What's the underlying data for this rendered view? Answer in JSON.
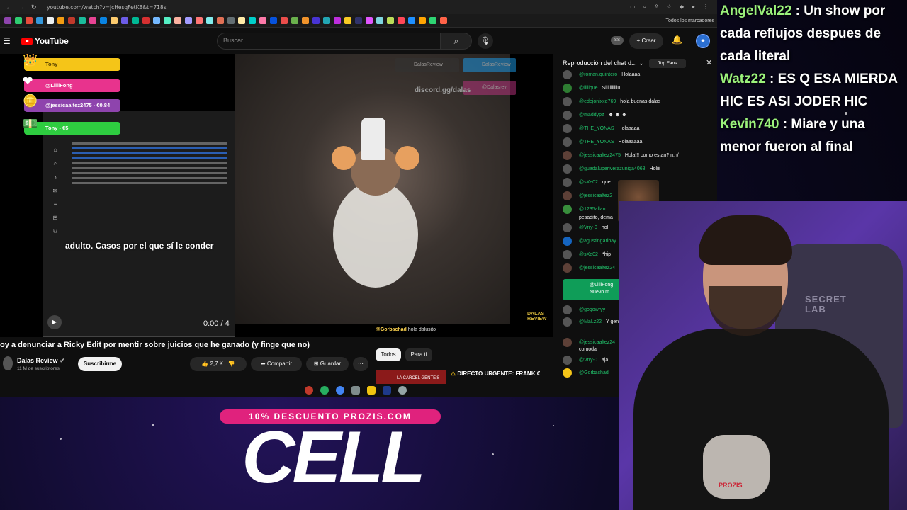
{
  "browser": {
    "url": "youtube.com/watch?v=jcHesqFetK8&t=718s",
    "bookmarks_all": "Todos los marcadores"
  },
  "youtube": {
    "logo": "YouTube",
    "search_placeholder": "Buscar",
    "create_label": "Crear",
    "ss_label": "SS"
  },
  "video": {
    "alerts": [
      {
        "label": "Tony",
        "color": "#f5c518",
        "icon": "crown-icon"
      },
      {
        "label": "@LilliFong",
        "color": "#e8338d",
        "icon": "heart-icon"
      },
      {
        "label": "@jessicaaltez2475 - €0.84",
        "color": "#8e44ad",
        "icon": "coin-icon"
      },
      {
        "label": "Tony - €5",
        "color": "#2ecc40",
        "icon": "money-icon"
      }
    ],
    "subtitle": "adulto. Casos por el que sí le conder",
    "time": "0:00 / 4",
    "discord": "discord.gg/dalas",
    "social": [
      "DalasReview",
      "@Dalasrev"
    ],
    "brand": [
      "DALAS",
      "REVIEW"
    ],
    "chat_user": "@Gorbachad",
    "chat_text": "hola dalusito"
  },
  "meta": {
    "title": "oy a denunciar a Ricky Edit por mentir sobre juicios que he ganado (y finge que no)",
    "channel": "Dalas Review",
    "subscribers": "11 M de suscriptores",
    "subscribe_label": "Suscribirme",
    "likes": "2,7 K",
    "share_label": "Compartir",
    "save_label": "Guardar",
    "chips": [
      "Todos",
      "Para ti"
    ],
    "rec_title": "DIRECTO URGENTE: FRANK CUESTA CONTRA LA MAFRASH",
    "rec_thumb_text": "LA CÁRCEL GENTE'S"
  },
  "chat": {
    "header": "Reproducción del chat d...",
    "top_fans": "Top Fans",
    "messages": [
      {
        "user": "@roman.quintero",
        "text": "Holaaaa",
        "highlight": true
      },
      {
        "user": "@llllique",
        "text": "Siiiiiiiiiiiu",
        "highlight": true
      },
      {
        "user": "@edejonixxd769",
        "text": "hola buenas dalas",
        "highlight": true
      },
      {
        "user": "@maddypz",
        "text": "",
        "highlight": true
      },
      {
        "user": "@THE_YONAS",
        "text": "Holaaaaa",
        "highlight": true
      },
      {
        "user": "@THE_YONAS",
        "text": "Holaaaaaa",
        "highlight": true
      },
      {
        "user": "@jessicaaltez2475",
        "text": "Hola!!! como estan? n.n/",
        "highlight": true
      },
      {
        "user": "@guadaluperiverazuniga4068",
        "text": "Holiii",
        "highlight": true
      },
      {
        "user": "@sXe02",
        "text": "que",
        "highlight": true
      },
      {
        "user": "@jessicaaltez2",
        "text": "jejaja",
        "highlight": true
      },
      {
        "user": "@1235allan",
        "text": "pesadito, dema",
        "highlight": true
      },
      {
        "user": "@Vrry-0",
        "text": "hol",
        "highlight": true
      },
      {
        "user": "@agustingaribay",
        "text": "",
        "highlight": true
      },
      {
        "user": "@sXe02",
        "text": "*hip",
        "highlight": true
      },
      {
        "user": "@jessicaaltez24",
        "text": "",
        "highlight": true
      }
    ],
    "member": {
      "user": "@LilliFong",
      "text": "Nuevo m"
    },
    "messages2": [
      {
        "user": "@gogowryy",
        "text": ""
      },
      {
        "user": "@MaLz22",
        "text": "Y genial"
      },
      {
        "user": "@jessicaaltez24",
        "text": "comoda"
      },
      {
        "user": "@Vrry-0",
        "text": "aja"
      },
      {
        "user": "@Gorbachad",
        "text": ""
      }
    ],
    "emote_text": "x3"
  },
  "overlay_chat": [
    {
      "user": "AngelVal22",
      "text": ": Un show por cada reflujos despues de cada literal"
    },
    {
      "user": "Watz22",
      "text": ": ES Q ESA MIERDA HIC ES ASI JODER HIC"
    },
    {
      "user": "Kevin740",
      "text": ": Miare y una menor fueron al final"
    }
  ],
  "webcam": {
    "chair_logo": [
      "SECRET",
      "LAB"
    ],
    "shirt_text": "PROZIS"
  },
  "promo": {
    "code": "10% DESCUENTO PROZIS.COM",
    "word": "CELL"
  }
}
